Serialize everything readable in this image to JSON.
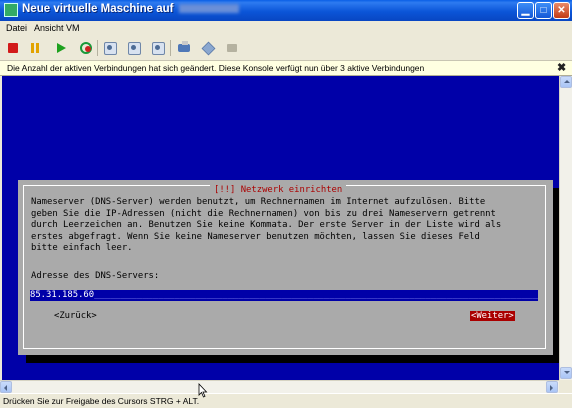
{
  "window": {
    "title": "Neue virtuelle Maschine auf",
    "buttons": [
      "minimize",
      "maximize",
      "close"
    ]
  },
  "menu": {
    "items": [
      "Datei",
      "Ansicht",
      "VM"
    ]
  },
  "toolbar": {
    "icons": [
      "stop-icon",
      "pause-icon",
      "play-icon",
      "reset-icon",
      "snapshot-icon",
      "revert-snapshot-icon",
      "manage-snapshots-icon",
      "network-icon",
      "vm-tools-icon",
      "disabled-icon"
    ]
  },
  "infobar": {
    "message": "Die Anzahl der aktiven Verbindungen hat sich geändert. Diese Konsole verfügt nun über 3 aktive Verbindungen",
    "close_glyph": "✖"
  },
  "dialog": {
    "title": "[!!] Netzwerk einrichten",
    "text": "Nameserver (DNS-Server) werden benutzt, um Rechnernamen im Internet aufzulösen. Bitte\ngeben Sie die IP-Adressen (nicht die Rechnernamen) von bis zu drei Nameservern getrennt\ndurch Leerzeichen an. Benutzen Sie keine Kommata. Der erste Server in der Liste wird als\nerstes abgefragt. Wenn Sie keine Nameserver benutzen möchten, lassen Sie dieses Feld\nbitte einfach leer.",
    "field_label": "Adresse des DNS-Servers:",
    "field_value": "85.31.185.60",
    "field_fill": "_____________________________________________________________________________________",
    "back_button": "<Zurück>",
    "next_button": "<Weiter>"
  },
  "statusbar": {
    "text": "Drücken Sie zur Freigabe des Cursors STRG + ALT."
  },
  "colors": {
    "console_bg": "#0000A8",
    "dialog_bg": "#AAAAAA",
    "title_red": "#AA0000",
    "titlebar_blue": "#0B55D8",
    "infobar_bg": "#FFFFE1"
  }
}
